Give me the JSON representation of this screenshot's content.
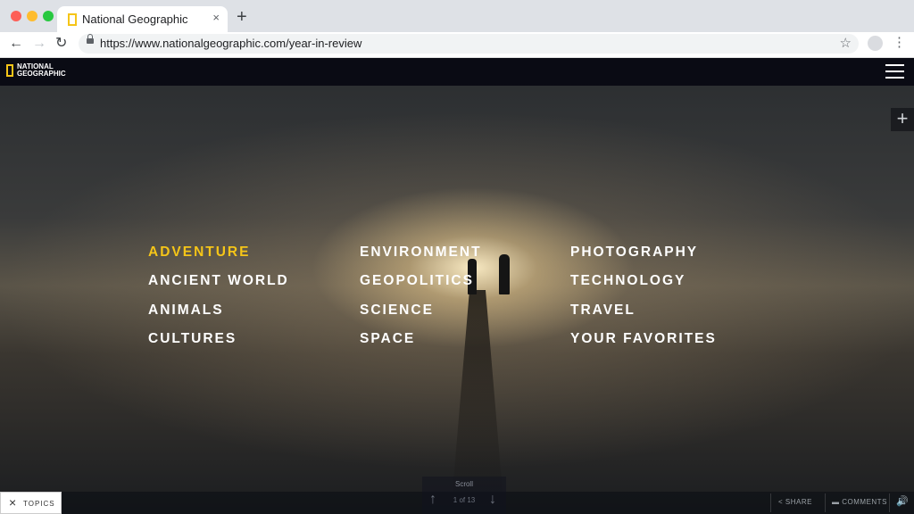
{
  "browser": {
    "tab_title": "National Geographic",
    "tab_close": "×",
    "new_tab": "+",
    "url": "https://www.nationalgeographic.com/year-in-review",
    "star": "☆",
    "menu": "⋮",
    "back": "←",
    "forward": "→",
    "reload": "↻"
  },
  "header": {
    "logo_line1": "NATIONAL",
    "logo_line2": "GEOGRAPHIC",
    "plus": "+"
  },
  "topics": {
    "col1": [
      "ADVENTURE",
      "ANCIENT WORLD",
      "ANIMALS",
      "CULTURES"
    ],
    "col2": [
      "ENVIRONMENT",
      "GEOPOLITICS",
      "SCIENCE",
      "SPACE"
    ],
    "col3": [
      "PHOTOGRAPHY",
      "TECHNOLOGY",
      "TRAVEL",
      "YOUR FAVORITES"
    ],
    "active": "ADVENTURE",
    "active_color": "#f5c518"
  },
  "footer": {
    "topics_close": "×",
    "topics_label": "TOPICS",
    "scroll_label": "Scroll",
    "counter": "1 of 13",
    "up": "↑",
    "down": "↓",
    "share_label": "SHARE",
    "comments_label": "COMMENTS",
    "sound": "🔊"
  }
}
